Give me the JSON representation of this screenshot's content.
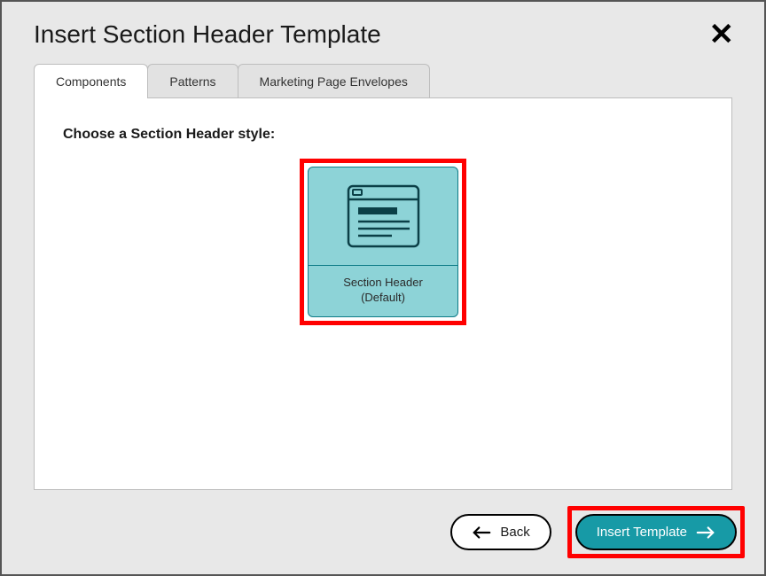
{
  "dialog": {
    "title": "Insert Section Header Template"
  },
  "tabs": {
    "components": "Components",
    "patterns": "Patterns",
    "envelopes": "Marketing Page Envelopes"
  },
  "content": {
    "prompt": "Choose a Section Header style:",
    "template": {
      "labelLine1": "Section Header",
      "labelLine2": "(Default)"
    }
  },
  "footer": {
    "back": "Back",
    "insert": "Insert Template"
  }
}
